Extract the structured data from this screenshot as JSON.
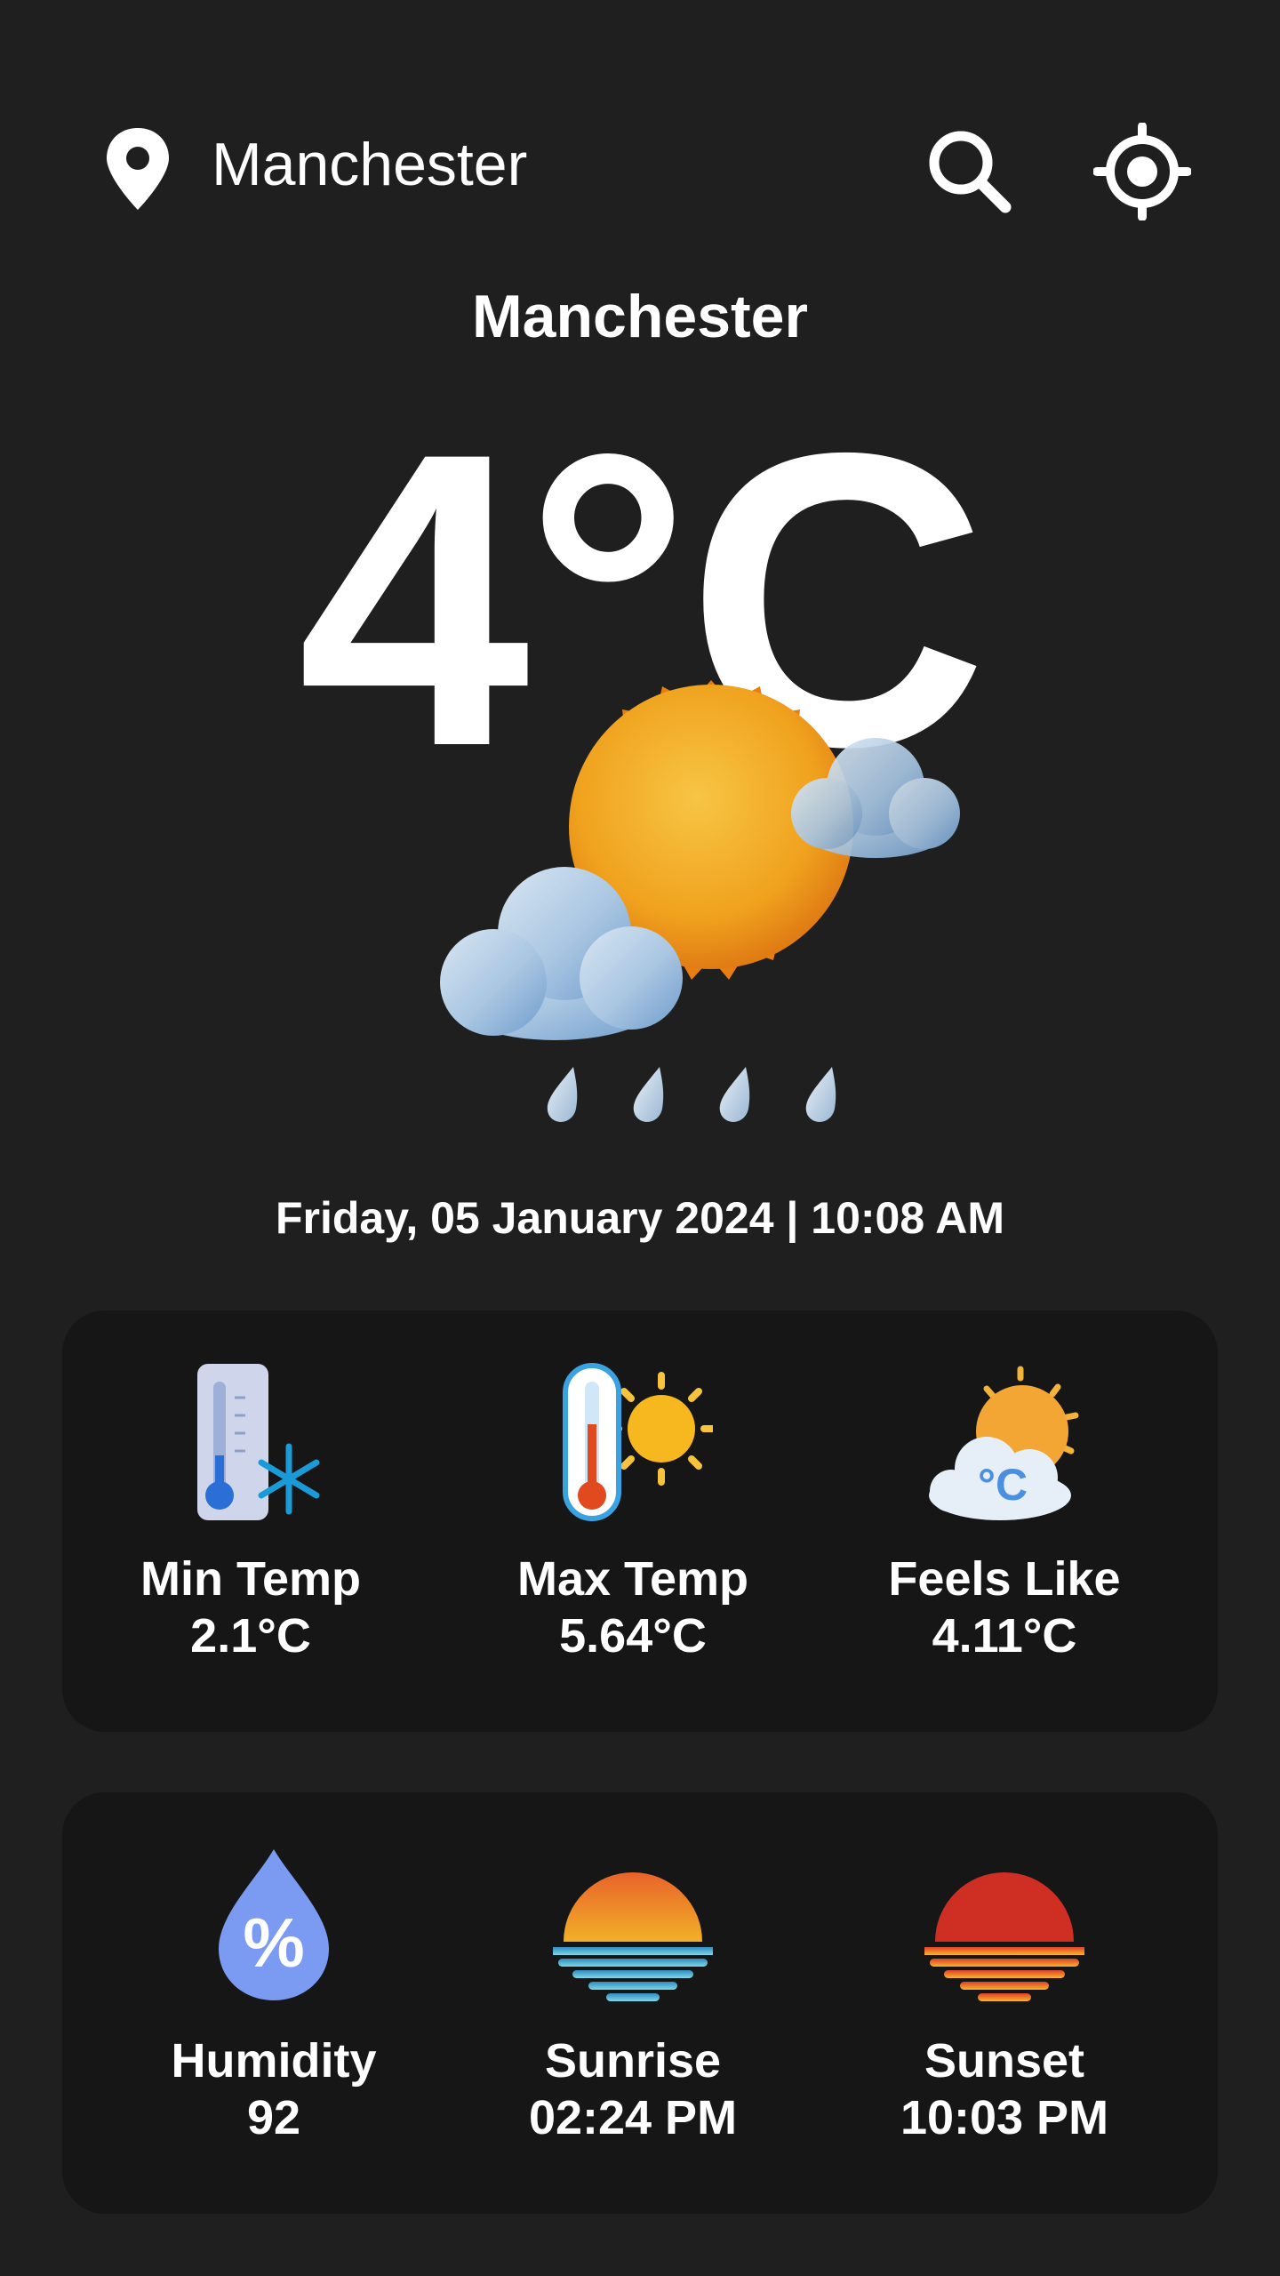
{
  "header": {
    "location_query": "Manchester",
    "icons": {
      "location": "location-pin-icon",
      "search": "search-icon",
      "gps": "gps-target-icon"
    }
  },
  "current": {
    "city": "Manchester",
    "temperature": "4°C",
    "condition_icon": "sun-cloud-rain-icon",
    "datetime": "Friday, 05 January 2024 | 10:08 AM"
  },
  "stats_row1": [
    {
      "label": "Min Temp",
      "value": "2.1°C",
      "icon": "thermometer-cold-icon"
    },
    {
      "label": "Max Temp",
      "value": "5.64°C",
      "icon": "thermometer-hot-icon"
    },
    {
      "label": "Feels Like",
      "value": "4.11°C",
      "icon": "feels-like-icon"
    }
  ],
  "stats_row2": [
    {
      "label": "Humidity",
      "value": "92",
      "icon": "humidity-drop-icon"
    },
    {
      "label": "Sunrise",
      "value": "02:24 PM",
      "icon": "sunrise-icon"
    },
    {
      "label": "Sunset",
      "value": "10:03 PM",
      "icon": "sunset-icon"
    }
  ],
  "colors": {
    "background": "#1f1f1f",
    "card": "#161616",
    "text": "#ffffff"
  }
}
